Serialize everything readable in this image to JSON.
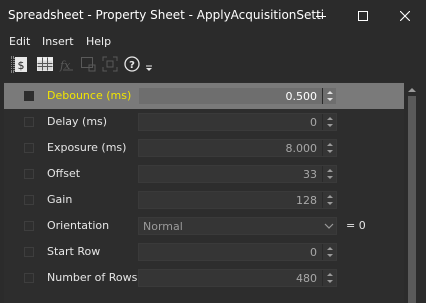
{
  "window": {
    "title": "Spreadsheet - Property Sheet - ApplyAcquisitionSetti"
  },
  "menu": {
    "items": [
      {
        "label": "Edit"
      },
      {
        "label": "Insert"
      },
      {
        "label": "Help"
      }
    ]
  },
  "toolbar": {
    "icons": [
      "categorized-view-icon",
      "alphabetical-grid-icon",
      "expression-icon",
      "capture-region-icon",
      "fit-region-icon",
      "help-icon",
      "overflow-chevron-icon"
    ]
  },
  "properties": [
    {
      "name": "Debounce (ms)",
      "value": "0.500",
      "checked": false,
      "selected": true
    },
    {
      "name": "Delay (ms)",
      "value": "0",
      "checked": false
    },
    {
      "name": "Exposure (ms)",
      "value": "8.000",
      "checked": false
    },
    {
      "name": "Offset",
      "value": "33",
      "checked": false
    },
    {
      "name": "Gain",
      "value": "128",
      "checked": false
    },
    {
      "name": "Orientation",
      "value": "Normal",
      "suffix": "= 0",
      "checked": false,
      "type": "dropdown"
    },
    {
      "name": "Start Row",
      "value": "0",
      "checked": false
    },
    {
      "name": "Number of Rows",
      "value": "480",
      "checked": false
    }
  ],
  "colors": {
    "background": "#2b2b2b",
    "selected_row": "#7a7a7a",
    "selected_label": "#f2e600"
  }
}
